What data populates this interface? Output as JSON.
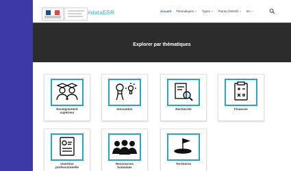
{
  "header": {
    "brand": "#dataESR",
    "nav": [
      {
        "label": "Accueil",
        "active": true,
        "dropdown": false
      },
      {
        "label": "Thématiques",
        "active": false,
        "dropdown": true
      },
      {
        "label": "Types",
        "active": false,
        "dropdown": true
      },
      {
        "label": "Points d'intérêt",
        "active": false,
        "dropdown": true
      },
      {
        "label": "En",
        "active": false,
        "dropdown": true
      }
    ],
    "dropdown_glyph": "⌄"
  },
  "banner": {
    "title": "Explorer par thématiques"
  },
  "cards": [
    {
      "label_lines": [
        "Enseignement",
        "supérieur"
      ],
      "icon": "graduates-icon"
    },
    {
      "label_lines": [
        "Innovation"
      ],
      "icon": "innovation-icon"
    },
    {
      "label_lines": [
        "Recherche"
      ],
      "icon": "research-icon"
    },
    {
      "label_lines": [
        "Finances"
      ],
      "icon": "finances-icon"
    },
    {
      "label_lines": [
        "Insertion",
        "professionnelle"
      ],
      "icon": "insertion-icon"
    },
    {
      "label_lines": [
        "Ressources",
        "humaines"
      ],
      "icon": "human-resources-icon"
    },
    {
      "label_lines": [
        "Territoires"
      ],
      "icon": "territories-icon"
    }
  ],
  "colors": {
    "accent": "#24a3c6",
    "brand": "#5ec1d8",
    "banner_bg": "#2c2c2c",
    "background": "#3c3aa6",
    "flag_blue": "#0055a4",
    "flag_red": "#ef4135"
  }
}
